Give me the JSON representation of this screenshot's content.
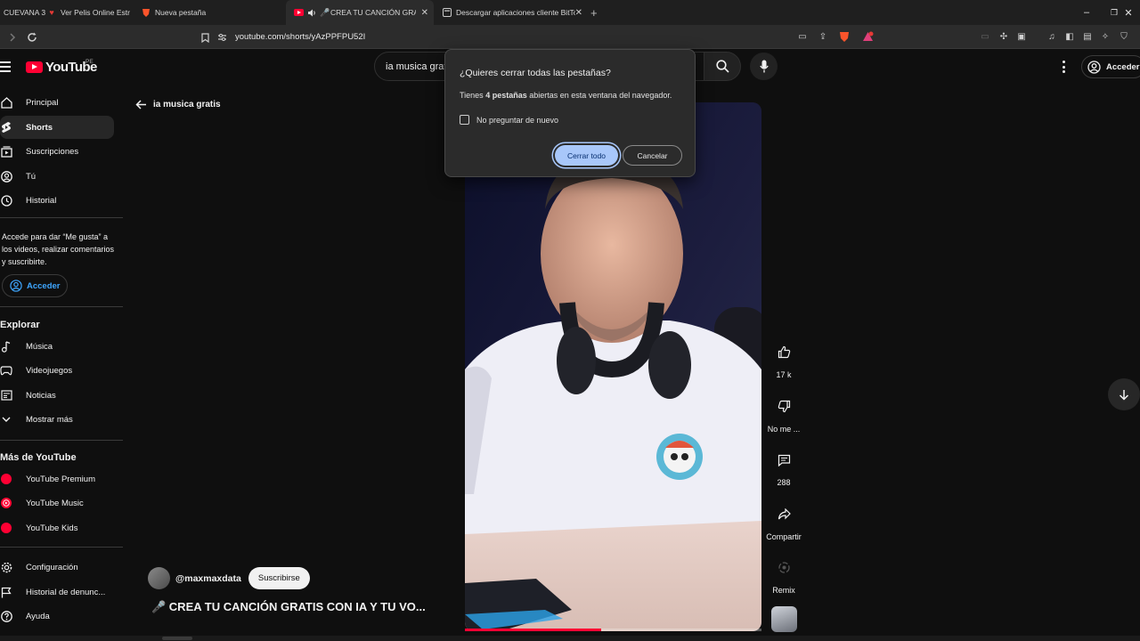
{
  "browser": {
    "tabs": [
      {
        "label": "CUEVANA 3",
        "active": false
      },
      {
        "label": "Ver Pelis Online Estr",
        "active": false
      },
      {
        "label": "Nueva pestaña",
        "active": false
      },
      {
        "label": "CREA TU CANCIÓN GRATI",
        "active": true
      },
      {
        "label": "Descargar aplicaciones cliente BitTorr",
        "active": false
      }
    ],
    "url": "youtube.com/shorts/yAzPPFPU52I",
    "new_tab_symbol": "+",
    "window_controls": {
      "minimize": "–",
      "maximize": "❐",
      "close": "✕"
    }
  },
  "youtube": {
    "logo_text": "YouTube",
    "region": "PE",
    "search_value": "ia musica grat",
    "signin_label": "Acceder"
  },
  "sidebar": {
    "items": [
      {
        "label": "Principal",
        "icon": "home-icon"
      },
      {
        "label": "Shorts",
        "icon": "shorts-icon",
        "active": true
      },
      {
        "label": "Suscripciones",
        "icon": "subscriptions-icon"
      },
      {
        "label": "Tú",
        "icon": "you-icon"
      },
      {
        "label": "Historial",
        "icon": "history-icon"
      }
    ],
    "signin_note": "Accede para dar “Me gusta” a los videos, realizar comentarios y suscribirte.",
    "signin_button": "Acceder",
    "explore_heading": "Explorar",
    "explore_items": [
      {
        "label": "Música",
        "icon": "music-icon"
      },
      {
        "label": "Videojuegos",
        "icon": "gaming-icon"
      },
      {
        "label": "Noticias",
        "icon": "news-icon"
      },
      {
        "label": "Mostrar más",
        "icon": "chevron-down-icon"
      }
    ],
    "more_heading": "Más de YouTube",
    "more_items": [
      {
        "label": "YouTube Premium"
      },
      {
        "label": "YouTube Music"
      },
      {
        "label": "YouTube Kids"
      }
    ],
    "footer_items": [
      {
        "label": "Configuración",
        "icon": "gear-icon"
      },
      {
        "label": "Historial de denunc...",
        "icon": "flag-icon"
      },
      {
        "label": "Ayuda",
        "icon": "help-icon"
      }
    ]
  },
  "short": {
    "back_label": "ia musica gratis",
    "channel": "@maxmaxdata",
    "subscribe": "Suscribirse",
    "title": "🎤 CREA TU CANCIÓN GRATIS CON IA Y TU VO...",
    "progress": 0.46,
    "actions": {
      "likes": "17 k",
      "dislike": "No me ...",
      "comments": "288",
      "share": "Compartir",
      "remix": "Remix"
    }
  },
  "dialog": {
    "title": "¿Quieres cerrar todas las pestañas?",
    "text_prefix": "Tienes ",
    "text_bold": "4 pestañas",
    "text_suffix": " abiertas en esta ventana del navegador.",
    "checkbox_label": "No preguntar de nuevo",
    "checkbox_checked": false,
    "confirm": "Cerrar todo",
    "cancel": "Cancelar"
  },
  "colors": {
    "accent_red": "#ff0033",
    "link_blue": "#3ea6ff",
    "dialog_primary": "#a8c7fa"
  }
}
